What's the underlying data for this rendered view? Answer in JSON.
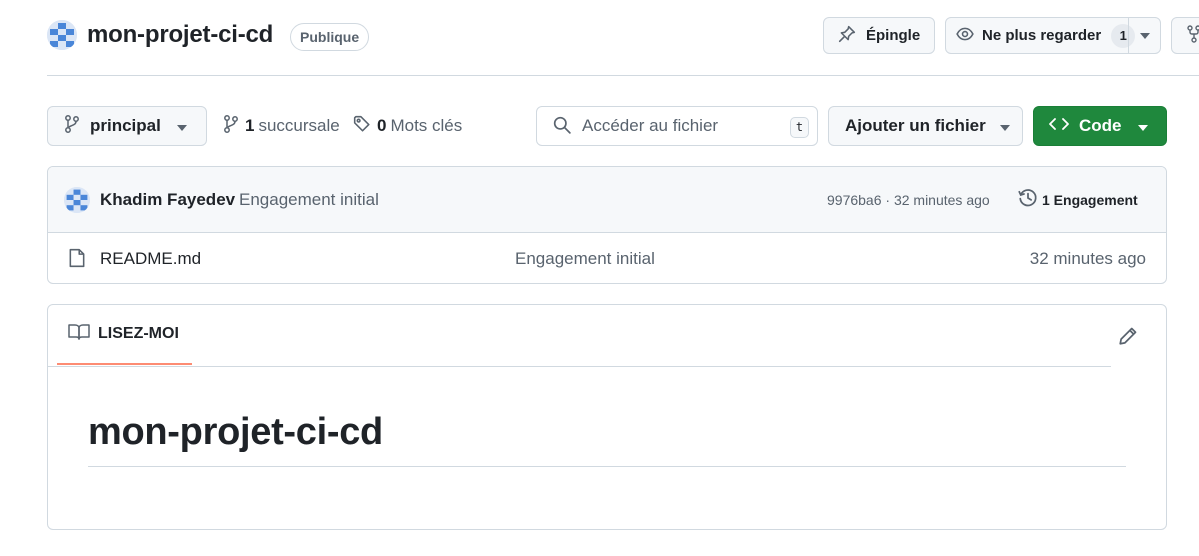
{
  "repo": {
    "name": "mon-projet-ci-cd",
    "visibility": "Publique"
  },
  "actions": {
    "pin_label": "Épingle",
    "watch_label": "Ne plus regarder",
    "watch_count": "1"
  },
  "toolbar": {
    "branch": "principal",
    "branches_count": "1",
    "branches_label": "succursale",
    "tags_count": "0",
    "tags_label": "Mots clés",
    "search_placeholder": "Accéder au fichier",
    "search_shortcut": "t",
    "add_file_label": "Ajouter un fichier",
    "code_label": "Code"
  },
  "latest_commit": {
    "author": "Khadim Fayedev",
    "message": "Engagement initial",
    "meta": "9976ba6 · 32 minutes ago",
    "commits_label": "1 Engagement"
  },
  "files": [
    {
      "name": "README.md",
      "commit": "Engagement initial",
      "age": "32 minutes ago"
    }
  ],
  "readme": {
    "tab_label": "LISEZ-MOI",
    "heading": "mon-projet-ci-cd"
  },
  "colors": {
    "primary_button": "#1f883d",
    "tab_underline": "#fd8c73",
    "border": "#d1d9e0",
    "muted_text": "#59636e"
  }
}
